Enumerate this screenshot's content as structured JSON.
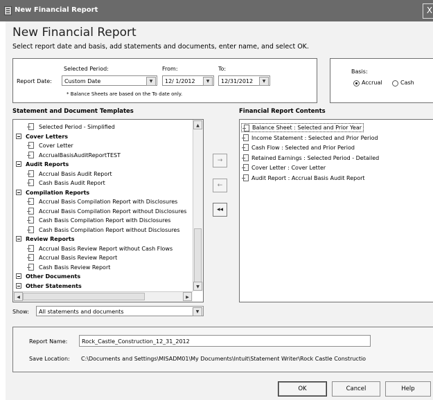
{
  "window": {
    "title": "New Financial Report",
    "close_glyph": "X"
  },
  "header": {
    "title": "New Financial Report",
    "instructions": "Select report date and basis, add statements and documents, enter name, and select OK."
  },
  "report_date": {
    "label": "Report Date:",
    "selected_period_label": "Selected Period:",
    "selected_period_value": "Custom Date",
    "from_label": "From:",
    "from_value": "12/ 1/2012",
    "to_label": "To:",
    "to_value": "12/31/2012",
    "note": "* Balance Sheets are based on the To date only."
  },
  "basis": {
    "label": "Basis:",
    "options": [
      {
        "label": "Accrual",
        "selected": true
      },
      {
        "label": "Cash",
        "selected": false
      }
    ]
  },
  "templates": {
    "heading": "Statement and Document Templates",
    "items": [
      {
        "type": "doc",
        "label": "Selected Period - Simplified"
      },
      {
        "type": "group",
        "label": "Cover Letters"
      },
      {
        "type": "doc",
        "label": "Cover Letter"
      },
      {
        "type": "doc",
        "label": "AccrualBasisAuditReportTEST"
      },
      {
        "type": "group",
        "label": "Audit Reports"
      },
      {
        "type": "doc",
        "label": "Accrual Basis Audit Report"
      },
      {
        "type": "doc",
        "label": "Cash Basis Audit Report"
      },
      {
        "type": "group",
        "label": "Compilation Reports"
      },
      {
        "type": "doc",
        "label": "Accrual Basis Compilation Report with Disclosures"
      },
      {
        "type": "doc",
        "label": "Accrual Basis Compilation Report without Disclosures"
      },
      {
        "type": "doc",
        "label": "Cash Basis Compilation Report with Disclosures"
      },
      {
        "type": "doc",
        "label": "Cash Basis Compilation Report without Disclosures"
      },
      {
        "type": "group",
        "label": "Review Reports"
      },
      {
        "type": "doc",
        "label": "Accrual Basis Review Report without Cash Flows"
      },
      {
        "type": "doc",
        "label": "Accrual Basis Review Report"
      },
      {
        "type": "doc",
        "label": "Cash Basis Review Report"
      },
      {
        "type": "group",
        "label": "Other Documents"
      },
      {
        "type": "group",
        "label": "Other Statements"
      }
    ]
  },
  "show": {
    "label": "Show:",
    "value": "All statements and documents"
  },
  "move_buttons": {
    "add": "→",
    "remove": "←",
    "remove_all": "◂◂"
  },
  "contents": {
    "heading": "Financial Report Contents",
    "items": [
      "Balance Sheet : Selected and Prior Year",
      "Income Statement : Selected and Prior Period",
      "Cash Flow : Selected and Prior Period",
      "Retained Earnings : Selected Period - Detailed",
      "Cover Letter : Cover Letter",
      "Audit Report : Accrual Basis Audit Report"
    ]
  },
  "report_name": {
    "label": "Report Name:",
    "value": "Rock_Castle_Construction_12_31_2012"
  },
  "save_location": {
    "label": "Save Location:",
    "value": "C:\\Documents and Settings\\MISADM01\\My Documents\\Intuit\\Statement Writer\\Rock Castle Constructio"
  },
  "buttons": {
    "ok": "OK",
    "cancel": "Cancel",
    "help": "Help"
  }
}
